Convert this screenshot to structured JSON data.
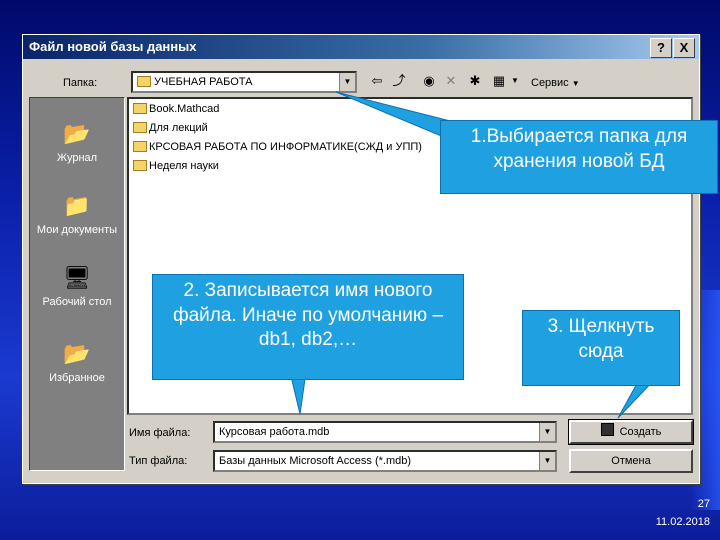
{
  "dialog": {
    "title": "Файл новой базы данных",
    "help_button": "?",
    "close_button": "X"
  },
  "folder_bar": {
    "label": "Папка:",
    "current_folder": "УЧЕБНАЯ РАБОТА",
    "tools_label": "Сервис"
  },
  "places": [
    {
      "label": "Журнал",
      "icon": "history-icon"
    },
    {
      "label": "Мои документы",
      "icon": "my-documents-icon"
    },
    {
      "label": "Рабочий стол",
      "icon": "desktop-icon"
    },
    {
      "label": "Избранное",
      "icon": "favorites-icon"
    }
  ],
  "files": [
    "Book.Mathcad",
    "Для лекций",
    "КРСОВАЯ РАБОТА ПО ИНФОРМАТИКЕ(СЖД и УПП)",
    "Неделя науки"
  ],
  "filename": {
    "label": "Имя файла:",
    "value": "Курсовая работа.mdb"
  },
  "filetype": {
    "label": "Тип файла:",
    "value": "Базы данных Microsoft Access (*.mdb)"
  },
  "buttons": {
    "create": "Создать",
    "cancel": "Отмена"
  },
  "callouts": {
    "folder": "1.Выбирается папка для хранения новой БД",
    "name": "2. Записывается имя нового файла. Иначе по умолчанию – db1, db2,…",
    "create": "3. Щелкнуть сюда"
  },
  "slide": {
    "page_number": "27",
    "date": "11.02.2018"
  },
  "colors": {
    "background": "#0a1fa8",
    "callout": "#1fa0e0",
    "dialog": "#d4d0c8",
    "titlebar": "#0a246a"
  }
}
